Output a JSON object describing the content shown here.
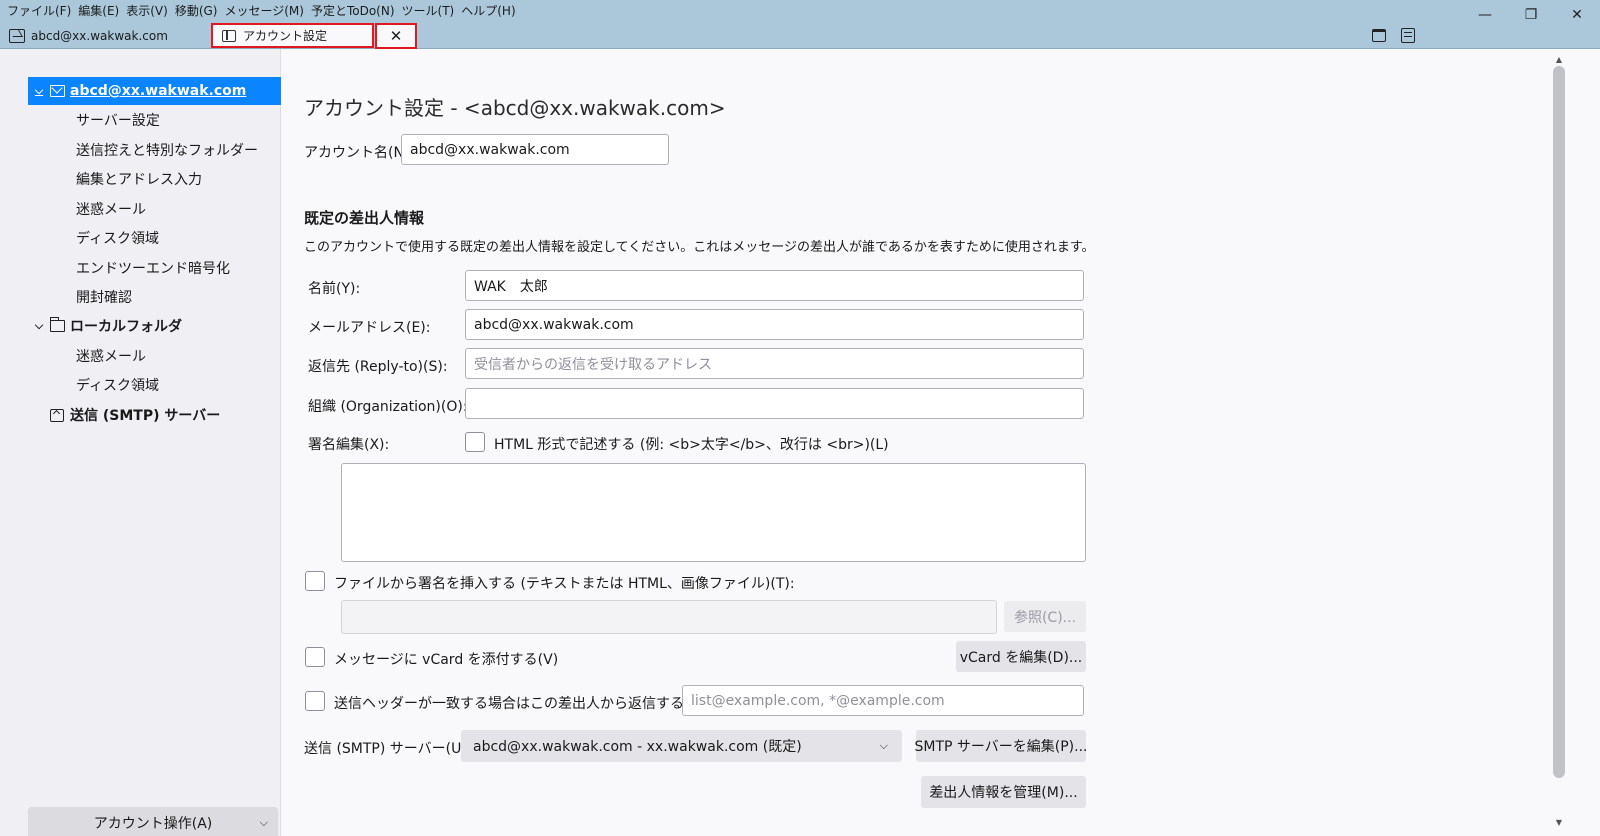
{
  "menubar": [
    "ファイル(F)",
    "編集(E)",
    "表示(V)",
    "移動(G)",
    "メッセージ(M)",
    "予定とToDo(N)",
    "ツール(T)",
    "ヘルプ(H)"
  ],
  "tabs": {
    "inbox": "abcd@xx.wakwak.com",
    "settings": "アカウント設定",
    "close_glyph": "✕"
  },
  "window_controls": {
    "minimize": "—",
    "restore": "❐",
    "close": "✕"
  },
  "sidebar": {
    "account": "abcd@xx.wakwak.com",
    "account_items": [
      "サーバー設定",
      "送信控えと特別なフォルダー",
      "編集とアドレス入力",
      "迷惑メール",
      "ディスク領域",
      "エンドツーエンド暗号化",
      "開封確認"
    ],
    "local_folders": "ローカルフォルダ",
    "local_items": [
      "迷惑メール",
      "ディスク領域"
    ],
    "smtp": "送信 (SMTP) サーバー",
    "account_actions": "アカウント操作(A)"
  },
  "main": {
    "title": "アカウント設定 - <abcd@xx.wakwak.com>",
    "account_name_label": "アカウント名(N):",
    "account_name_value": "abcd@xx.wakwak.com",
    "identity_heading": "既定の差出人情報",
    "identity_desc": "このアカウントで使用する既定の差出人情報を設定してください。これはメッセージの差出人が誰であるかを表すために使用されます。",
    "name_label": "名前(Y):",
    "name_value": "WAK　太郎",
    "email_label": "メールアドレス(E):",
    "email_value": "abcd@xx.wakwak.com",
    "replyto_label": "返信先 (Reply-to)(S):",
    "replyto_placeholder": "受信者からの返信を受け取るアドレス",
    "org_label": "組織 (Organization)(O):",
    "org_value": "",
    "signature_label": "署名編集(X):",
    "html_sig_label": "HTML 形式で記述する (例: <b>太字</b>、改行は <br>)(L)",
    "sig_file_label": "ファイルから署名を挿入する (テキストまたは HTML、画像ファイル)(T):",
    "browse_button": "参照(C)...",
    "vcard_label": "メッセージに vCard を添付する(V)",
    "vcard_button": "vCard を編集(D)...",
    "reply_from_label": "送信ヘッダーが一致する場合はこの差出人から返信する(D):",
    "reply_from_placeholder": "list@example.com, *@example.com",
    "smtp_label": "送信 (SMTP) サーバー(U):",
    "smtp_value": "abcd@xx.wakwak.com - xx.wakwak.com (既定)",
    "smtp_edit_button": "SMTP サーバーを編集(P)...",
    "manage_identities_button": "差出人情報を管理(M)..."
  }
}
